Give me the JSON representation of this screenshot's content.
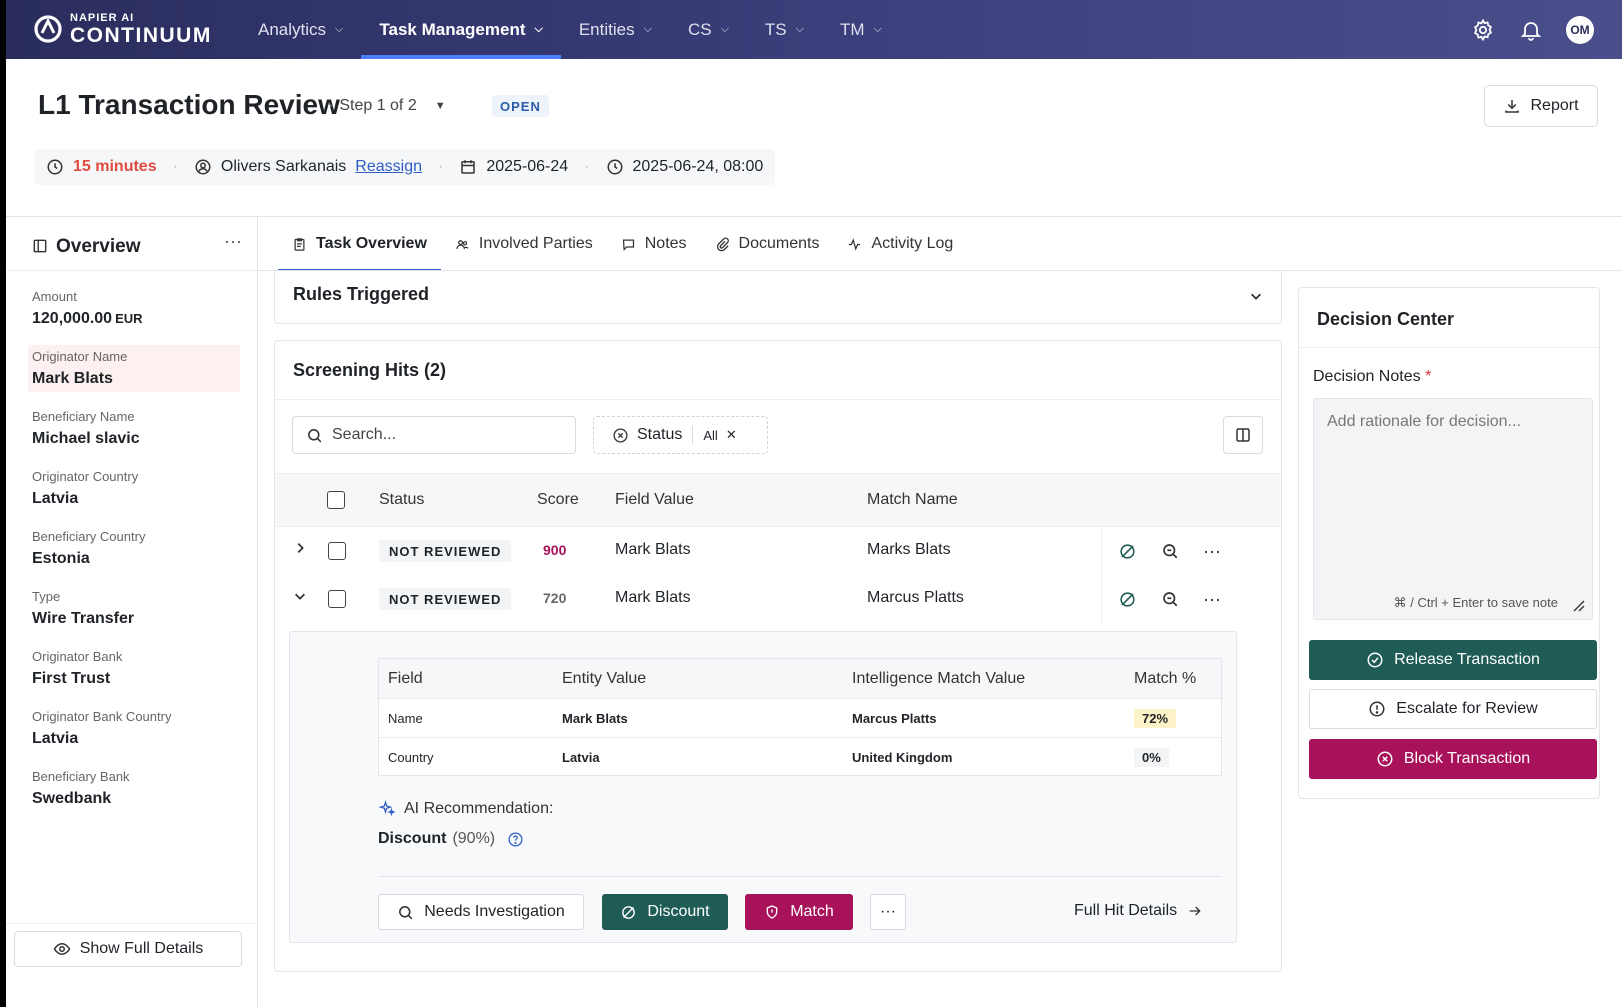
{
  "brand": {
    "top": "NAPIER AI",
    "main": "CONTINUUM"
  },
  "nav": {
    "items": [
      {
        "label": "Analytics",
        "active": false
      },
      {
        "label": "Task Management",
        "active": true
      },
      {
        "label": "Entities",
        "active": false
      },
      {
        "label": "CS",
        "active": false
      },
      {
        "label": "TS",
        "active": false
      },
      {
        "label": "TM",
        "active": false
      }
    ],
    "avatar": "OM"
  },
  "header": {
    "title": "L1 Transaction Review",
    "step": "Step 1 of 2",
    "status": "OPEN",
    "report_label": "Report",
    "sla": "15 minutes",
    "assignee": "Olivers Sarkanais",
    "reassign": "Reassign",
    "date": "2025-06-24",
    "datetime": "2025-06-24, 08:00"
  },
  "sidebar": {
    "title": "Overview",
    "fields": [
      {
        "label": "Amount",
        "value": "120,000.00",
        "unit": "EUR"
      },
      {
        "label": "Originator Name",
        "value": "Mark Blats"
      },
      {
        "label": "Beneficiary Name",
        "value": "Michael slavic"
      },
      {
        "label": "Originator Country",
        "value": "Latvia"
      },
      {
        "label": "Beneficiary Country",
        "value": "Estonia"
      },
      {
        "label": "Type",
        "value": "Wire Transfer"
      },
      {
        "label": "Originator Bank",
        "value": "First Trust"
      },
      {
        "label": "Originator Bank Country",
        "value": "Latvia"
      },
      {
        "label": "Beneficiary Bank",
        "value": "Swedbank"
      }
    ],
    "show_full": "Show Full Details"
  },
  "tabs": [
    {
      "label": "Task Overview",
      "active": true
    },
    {
      "label": "Involved Parties",
      "active": false
    },
    {
      "label": "Notes",
      "active": false
    },
    {
      "label": "Documents",
      "active": false
    },
    {
      "label": "Activity Log",
      "active": false
    }
  ],
  "rules": {
    "title": "Rules Triggered"
  },
  "hits": {
    "title": "Screening Hits (2)",
    "search_placeholder": "Search...",
    "filter_label": "Status",
    "filter_value": "All",
    "columns": [
      "Status",
      "Score",
      "Field Value",
      "Match Name"
    ],
    "rows": [
      {
        "status": "NOT REVIEWED",
        "score": "900",
        "field_value": "Mark Blats",
        "match_name": "Marks Blats",
        "score_color": "#a8125a",
        "expanded": false
      },
      {
        "status": "NOT REVIEWED",
        "score": "720",
        "field_value": "Mark Blats",
        "match_name": "Marcus Platts",
        "score_color": "#666666",
        "expanded": true
      }
    ],
    "detail": {
      "columns": [
        "Field",
        "Entity Value",
        "Intelligence Match Value",
        "Match %"
      ],
      "rows": [
        {
          "field": "Name",
          "entity": "Mark Blats",
          "intel": "Marcus Platts",
          "pct": "72%",
          "pct_bg": "#fdf3c8"
        },
        {
          "field": "Country",
          "entity": "Latvia",
          "intel": "United Kingdom",
          "pct": "0%",
          "pct_bg": "#f3f4f6"
        }
      ],
      "ai_label": "AI Recommendation:",
      "ai_decision": "Discount",
      "ai_pct": "(90%)",
      "buttons": {
        "investigate": "Needs Investigation",
        "discount": "Discount",
        "match": "Match",
        "full_hit": "Full Hit Details"
      }
    }
  },
  "decision": {
    "title": "Decision Center",
    "notes_label": "Decision Notes",
    "required": "*",
    "notes_placeholder": "Add rationale for decision...",
    "hint": "⌘ / Ctrl + Enter to save note",
    "release": "Release Transaction",
    "escalate": "Escalate for Review",
    "block": "Block Transaction"
  },
  "colors": {
    "accent_blue": "#2f5ec4",
    "green": "#1e5c55",
    "magenta": "#a8125a",
    "sla_red": "#e04b3f"
  }
}
